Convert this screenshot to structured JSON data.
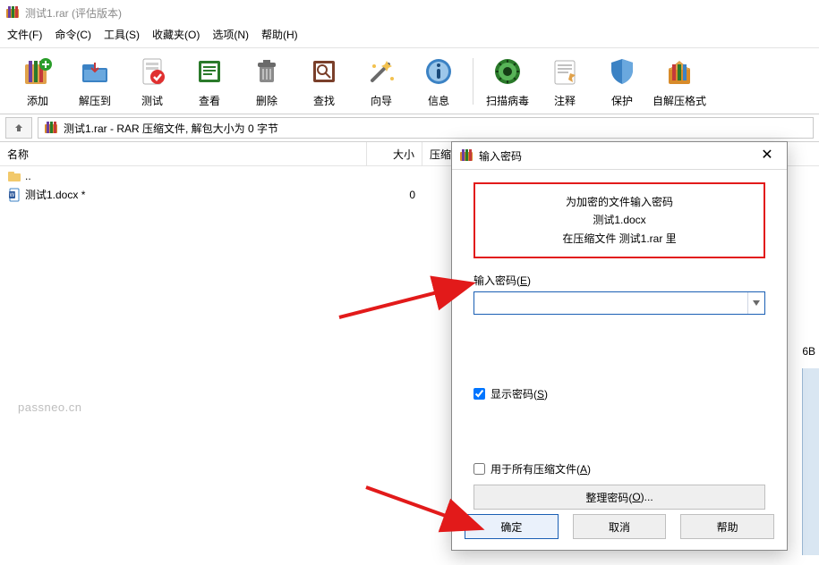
{
  "title": "测试1.rar (评估版本)",
  "menu": {
    "file": "文件(F)",
    "command": "命令(C)",
    "tools": "工具(S)",
    "favorites": "收藏夹(O)",
    "options": "选项(N)",
    "help": "帮助(H)"
  },
  "toolbar": {
    "add": "添加",
    "extract_to": "解压到",
    "test": "测试",
    "view": "查看",
    "delete": "删除",
    "find": "查找",
    "wizard": "向导",
    "info": "信息",
    "virus_scan": "扫描病毒",
    "comment": "注释",
    "protect": "保护",
    "sfx": "自解压格式"
  },
  "path_text": "测试1.rar - RAR 压缩文件, 解包大小为 0 字节",
  "columns": {
    "name": "名称",
    "size": "大小",
    "compressed": "压缩"
  },
  "rows": {
    "up": "..",
    "file1_name": "测试1.docx *",
    "file1_size": "0"
  },
  "overflow_text": "6B",
  "dialog": {
    "title": "输入密码",
    "msg1": "为加密的文件输入密码",
    "msg2": "测试1.docx",
    "msg3": "在压缩文件 测试1.rar 里",
    "pwd_label_pre": "输入密码(",
    "pwd_label_key": "E",
    "pwd_label_post": ")",
    "show_pre": "显示密码(",
    "show_key": "S",
    "show_post": ")",
    "all_pre": "用于所有压缩文件(",
    "all_key": "A",
    "all_post": ")",
    "manage_pre": "整理密码(",
    "manage_key": "O",
    "manage_post": ")...",
    "ok": "确定",
    "cancel": "取消",
    "help": "帮助"
  },
  "watermark": "passneo.cn"
}
